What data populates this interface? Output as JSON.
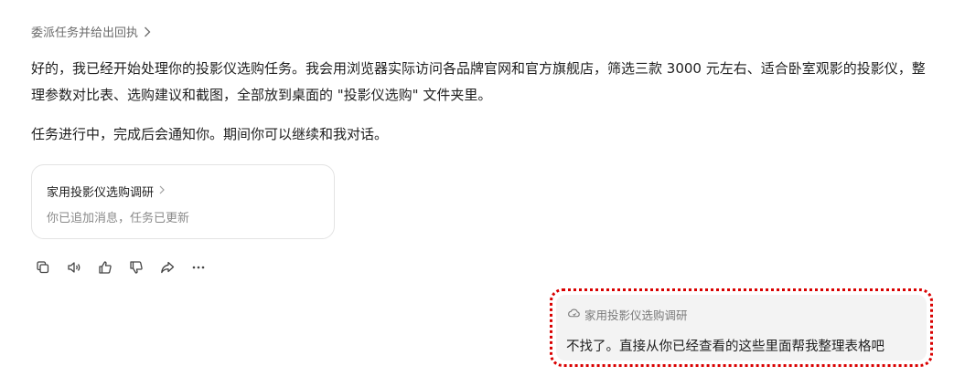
{
  "delegate": {
    "label": "委派任务并给出回执"
  },
  "assistant": {
    "paragraph_1": "好的，我已经开始处理你的投影仪选购任务。我会用浏览器实际访问各品牌官网和官方旗舰店，筛选三款 3000 元左右、适合卧室观影的投影仪，整理参数对比表、选购建议和截图，全部放到桌面的 \"投影仪选购\" 文件夹里。",
    "paragraph_2": "任务进行中，完成后会通知你。期间你可以继续和我对话。"
  },
  "task_card": {
    "title": "家用投影仪选购调研",
    "status": "你已追加消息，任务已更新"
  },
  "actions": [
    {
      "icon": "copy-icon"
    },
    {
      "icon": "speaker-icon"
    },
    {
      "icon": "thumbs-up-icon"
    },
    {
      "icon": "thumbs-down-icon"
    },
    {
      "icon": "share-icon"
    },
    {
      "icon": "more-icon"
    }
  ],
  "user_message": {
    "reference": "家用投影仪选购调研",
    "text": "不找了。直接从你已经查看的这些里面帮我整理表格吧"
  },
  "colors": {
    "highlight_border": "#d90000",
    "bubble_bg": "#f3f3f3",
    "muted_text": "#8a8a8a"
  }
}
